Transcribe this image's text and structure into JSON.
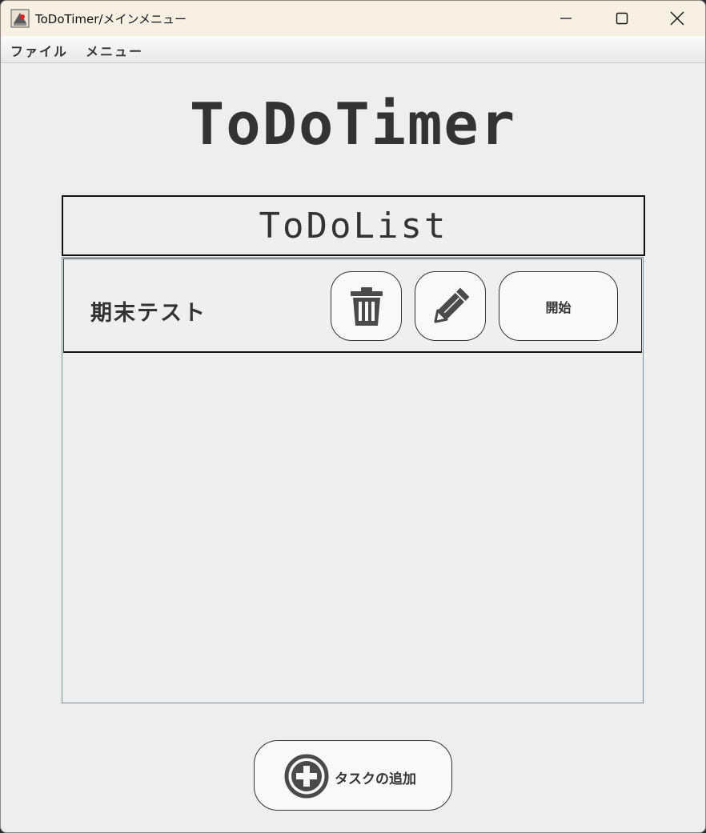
{
  "window": {
    "title": "ToDoTimer/メインメニュー",
    "controls": [
      "minimize-icon",
      "maximize-icon",
      "close-icon"
    ]
  },
  "menubar": {
    "items": [
      {
        "label": "ファイル"
      },
      {
        "label": "メニュー"
      }
    ]
  },
  "app": {
    "title": "ToDoTimer",
    "list_header": "ToDoList"
  },
  "tasks": [
    {
      "name": "期末テスト",
      "delete_icon": "trash-icon",
      "edit_icon": "pencil-icon",
      "start_label": "開始"
    }
  ],
  "footer": {
    "add_icon": "plus-circle-icon",
    "add_label": "タスクの追加"
  },
  "colors": {
    "window_bg": "#eeeeee",
    "titlebar_bg": "#f7f0e3",
    "text": "#333333",
    "button_bg": "#f9f9f9",
    "icon": "#4a4a4a"
  }
}
